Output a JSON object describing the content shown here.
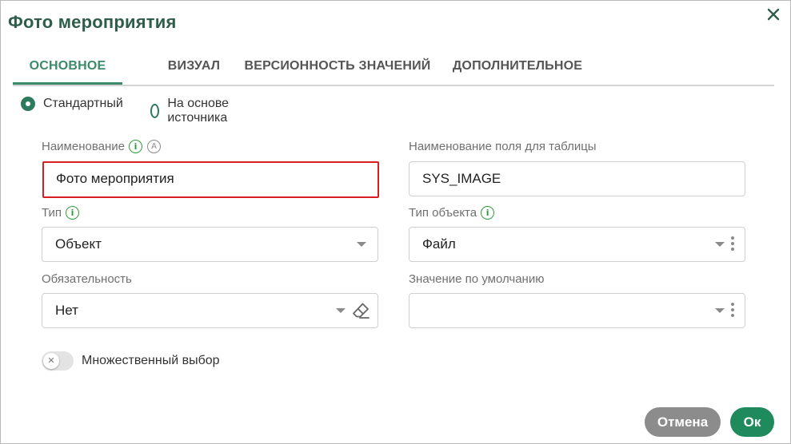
{
  "dialog": {
    "title": "Фото мероприятия",
    "close_icon": "close-icon"
  },
  "tabs": [
    {
      "label": "ОСНОВНОЕ",
      "active": true
    },
    {
      "label": "ВИЗУАЛ",
      "active": false
    },
    {
      "label": "ВЕРСИОННОСТЬ ЗНАЧЕНИЙ",
      "active": false
    },
    {
      "label": "ДОПОЛНИТЕЛЬНОЕ",
      "active": false
    }
  ],
  "mode": {
    "options": [
      {
        "label": "Стандартный",
        "selected": true
      },
      {
        "label": "На основе источника",
        "selected": false
      }
    ]
  },
  "form": {
    "name": {
      "label": "Наименование",
      "value": "Фото мероприятия",
      "auto_badge": "A"
    },
    "table_field": {
      "label": "Наименование поля для таблицы",
      "value": "SYS_IMAGE"
    },
    "type": {
      "label": "Тип",
      "value": "Объект"
    },
    "object_type": {
      "label": "Тип объекта",
      "value": "Файл"
    },
    "required": {
      "label": "Обязательность",
      "value": "Нет"
    },
    "default_value": {
      "label": "Значение по умолчанию",
      "value": ""
    },
    "multi_select": {
      "label": "Множественный выбор",
      "enabled": false
    }
  },
  "buttons": {
    "cancel": "Отмена",
    "ok": "Ок"
  },
  "colors": {
    "accent": "#3c8a6a",
    "title": "#2e5e4b",
    "error": "#d81f1f",
    "ok_button": "#1f8b5c",
    "cancel_button": "#8c8c8c",
    "info_icon": "#2f9a3e"
  }
}
